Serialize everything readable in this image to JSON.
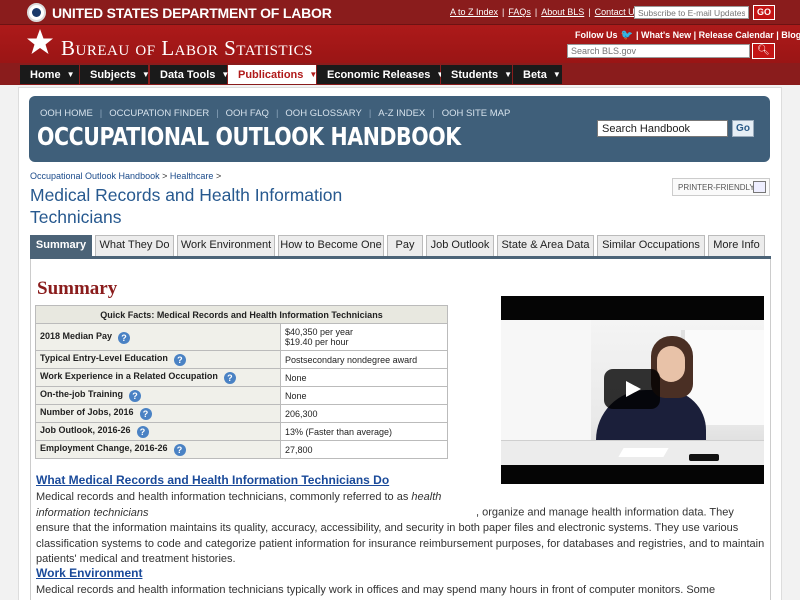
{
  "header": {
    "dol_name": "UNITED STATES DEPARTMENT OF LABOR",
    "links": [
      "A to Z Index",
      "FAQs",
      "About BLS",
      "Contact Us"
    ],
    "email_placeholder": "Subscribe to E-mail Updates",
    "email_go": "GO",
    "bls_name": "Bureau of Labor Statistics",
    "follow": [
      "Follow Us",
      "What's New",
      "Release Calendar",
      "Blog"
    ],
    "search_placeholder": "Search BLS.gov",
    "search_icon": "magnifier-icon"
  },
  "nav": {
    "items": [
      {
        "label": "Home"
      },
      {
        "label": "Subjects"
      },
      {
        "label": "Data Tools"
      },
      {
        "label": "Publications"
      },
      {
        "label": "Economic Releases"
      },
      {
        "label": "Students"
      },
      {
        "label": "Beta"
      }
    ],
    "active": "Publications"
  },
  "ooh": {
    "nav": [
      "OOH HOME",
      "OCCUPATION FINDER",
      "OOH FAQ",
      "OOH GLOSSARY",
      "A-Z INDEX",
      "OOH SITE MAP"
    ],
    "title": "OCCUPATIONAL OUTLOOK HANDBOOK",
    "search_value": "Search Handbook",
    "search_go": "Go"
  },
  "breadcrumb": {
    "items": [
      "Occupational Outlook Handbook",
      "Healthcare"
    ],
    "separator": ">"
  },
  "page": {
    "title": "Medical Records and Health Information Technicians",
    "printer_label": "PRINTER-FRIENDLY"
  },
  "tabs": [
    "Summary",
    "What They Do",
    "Work Environment",
    "How to Become One",
    "Pay",
    "Job Outlook",
    "State & Area Data",
    "Similar Occupations",
    "More Info"
  ],
  "active_tab": "Summary",
  "summary": {
    "heading": "Summary",
    "quick_facts_title": "Quick Facts: Medical Records and Health Information Technicians",
    "rows": [
      {
        "label": "2018 Median Pay",
        "value": "$40,350 per year",
        "value2": "$19.40 per hour"
      },
      {
        "label": "Typical Entry-Level Education",
        "value": "Postsecondary nondegree award"
      },
      {
        "label": "Work Experience in a Related Occupation",
        "value": "None"
      },
      {
        "label": "On-the-job Training",
        "value": "None"
      },
      {
        "label": "Number of Jobs, 2016",
        "value": "206,300"
      },
      {
        "label": "Job Outlook, 2016-26",
        "value": "13% (Faster than average)"
      },
      {
        "label": "Employment Change, 2016-26",
        "value": "27,800"
      }
    ],
    "help_glyph": "?"
  },
  "sections": {
    "what_they_do_heading": "What Medical Records and Health Information Technicians Do",
    "what_they_do_text_a": "Medical records and health information technicians, commonly referred to as ",
    "what_they_do_text_em": "health information technicians",
    "what_they_do_text_b": ", organize and manage health information data. They ensure that the information maintains its quality, accuracy, accessibility, and security in both paper files and electronic systems. They use various classification systems to code and categorize patient information for insurance reimbursement purposes, for databases and registries, and to maintain patients' medical and treatment histories.",
    "work_env_heading": "Work Environment",
    "work_env_text": "Medical records and health information technicians typically work in offices and may spend many hours in front of computer monitors. Some technicians may work"
  },
  "colors": {
    "header_red": "#8a1c1c",
    "ooh_blue": "#3f5f7a",
    "tab_active": "#4b6377",
    "link_blue": "#1a4a9a"
  }
}
